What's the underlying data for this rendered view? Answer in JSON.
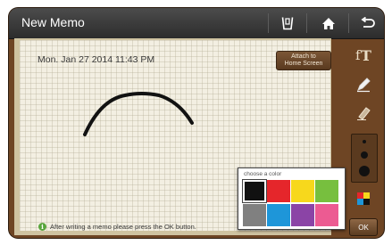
{
  "titlebar": {
    "title": "New Memo",
    "icons": [
      "clipboard-icon",
      "home-icon",
      "back-icon"
    ]
  },
  "memo": {
    "date": "Mon. Jan 27 2014 11:43 PM",
    "attach_label_line1": "Attach to",
    "attach_label_line2": "Home Screen",
    "hint": "After writing a memo please press the OK button.",
    "hint_icon": "i"
  },
  "sidebar": {
    "tools": [
      "text-icon",
      "pen-icon",
      "eraser-icon",
      "color-picker-icon"
    ],
    "pen_sizes": [
      "small",
      "medium",
      "large"
    ],
    "ok_label": "OK"
  },
  "palette": {
    "title": "choose a color",
    "colors": [
      "#111111",
      "#e5262b",
      "#f7d81c",
      "#77bf3e",
      "#808080",
      "#1e96d9",
      "#8b44a6",
      "#ec5b92"
    ],
    "selected": "#111111"
  }
}
